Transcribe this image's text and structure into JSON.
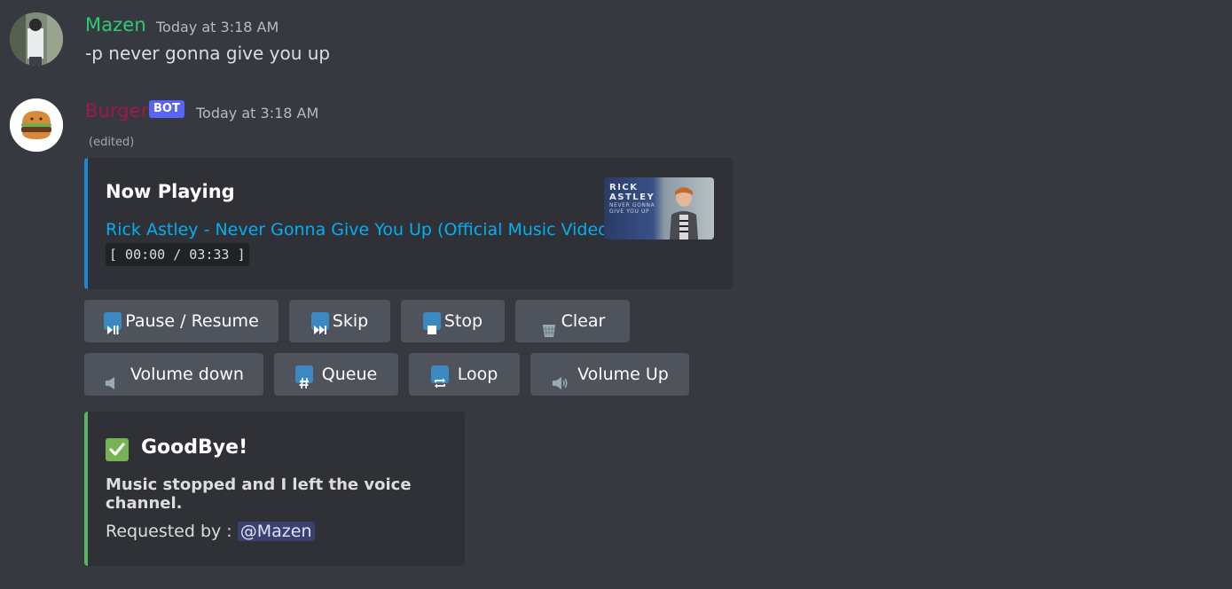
{
  "messages": [
    {
      "author": "Mazen",
      "author_color": "#2ecc71",
      "timestamp": "Today at 3:18 AM",
      "content": "-p never gonna give you up"
    },
    {
      "author": "Burger",
      "author_color": "#a0184e",
      "bot_tag": "BOT",
      "timestamp": "Today at 3:18 AM",
      "edited": "(edited)"
    }
  ],
  "now_playing": {
    "title": "Now Playing",
    "track_link": "Rick Astley - Never Gonna Give You Up (Official Music Video)",
    "progress": "[ 00:00 / 03:33 ]",
    "accent_color": "#1e88d4",
    "thumbnail": {
      "line1": "RICK",
      "line2": "ASTLEY",
      "line3": "NEVER GONNA",
      "line4": "GIVE YOU UP"
    }
  },
  "buttons": {
    "pause_resume": {
      "label": "Pause / Resume",
      "icon": "play-pause-icon"
    },
    "skip": {
      "label": "Skip",
      "icon": "next-track-icon"
    },
    "stop": {
      "label": "Stop",
      "icon": "stop-icon"
    },
    "clear": {
      "label": "Clear",
      "icon": "wastebasket-icon"
    },
    "volume_down": {
      "label": "Volume down",
      "icon": "speaker-low-icon"
    },
    "queue": {
      "label": "Queue",
      "icon": "hash-icon"
    },
    "loop": {
      "label": "Loop",
      "icon": "repeat-icon"
    },
    "volume_up": {
      "label": "Volume Up",
      "icon": "speaker-high-icon"
    }
  },
  "goodbye": {
    "title": "GoodBye!",
    "description": "Music stopped and I left the voice channel.",
    "requested_label": "Requested by :",
    "mention": "@Mazen",
    "accent_color": "#57b65f"
  }
}
